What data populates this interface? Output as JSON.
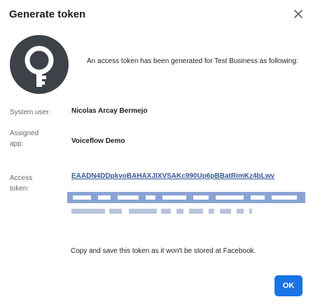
{
  "dialog": {
    "title": "Generate token",
    "close_icon": "close-icon",
    "key_icon": "key-icon",
    "intro_text": "An access token has been generated for Test Business as following:",
    "fields": {
      "system_user": {
        "label": "System user:",
        "value": "Nicolas Arcay Bermejo"
      },
      "assigned_app": {
        "label_line1": "Assigned",
        "label_line2": "app:",
        "value": "Voiceflow Demo"
      },
      "access_token": {
        "label_line1": "Access",
        "label_line2": "token:",
        "value": "EAADN4DDpkvoBAHAXJIXVSAKc990Up6pBBatRimKz4bLwv"
      }
    },
    "note": "Copy and save this token as it won't be stored at Facebook.",
    "ok_label": "OK"
  },
  "colors": {
    "primary_button": "#1b74e4",
    "link": "#385898",
    "token_highlight": "#8aa3d6",
    "avatar_bg": "#3d4148"
  }
}
